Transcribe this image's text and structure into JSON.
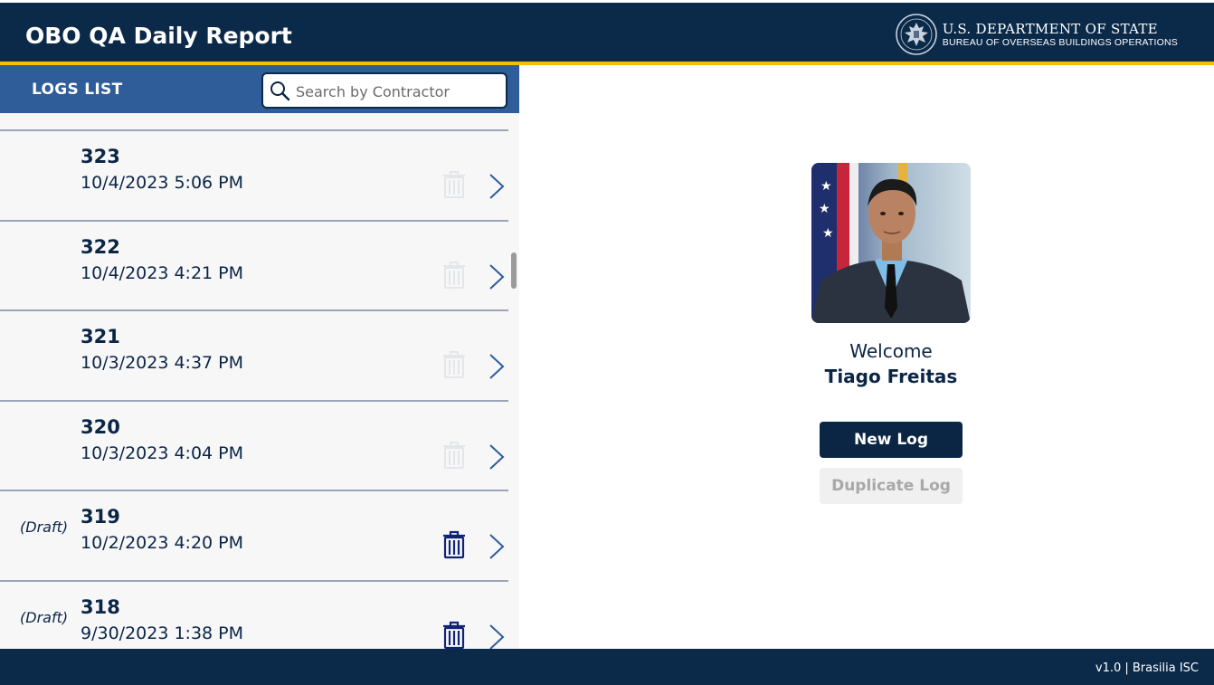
{
  "header": {
    "title": "OBO QA Daily Report",
    "dept_line1": "U.S. DEPARTMENT OF STATE",
    "dept_line2": "BUREAU OF OVERSEAS BUILDINGS OPERATIONS"
  },
  "logs_panel": {
    "title": "LOGS LIST",
    "search_placeholder": "Search by Contractor",
    "items": [
      {
        "draft": "",
        "number": "323",
        "date": "10/4/2023 5:06 PM",
        "deletable": false
      },
      {
        "draft": "",
        "number": "322",
        "date": "10/4/2023 4:21 PM",
        "deletable": false
      },
      {
        "draft": "",
        "number": "321",
        "date": "10/3/2023 4:37 PM",
        "deletable": false
      },
      {
        "draft": "",
        "number": "320",
        "date": "10/3/2023 4:04 PM",
        "deletable": false
      },
      {
        "draft": "(Draft)",
        "number": "319",
        "date": "10/2/2023 4:20 PM",
        "deletable": true
      },
      {
        "draft": "(Draft)",
        "number": "318",
        "date": "9/30/2023 1:38 PM",
        "deletable": true
      }
    ]
  },
  "welcome": {
    "greeting": "Welcome",
    "user_name": "Tiago Freitas",
    "new_log_label": "New Log",
    "duplicate_log_label": "Duplicate Log"
  },
  "footer": {
    "version": "v1.0 | Brasilia ISC"
  },
  "colors": {
    "navy": "#0b2a4a",
    "accent_gold": "#f2c200",
    "logs_bar_blue": "#2e5d99",
    "disabled_gray": "#a8a8a8"
  }
}
